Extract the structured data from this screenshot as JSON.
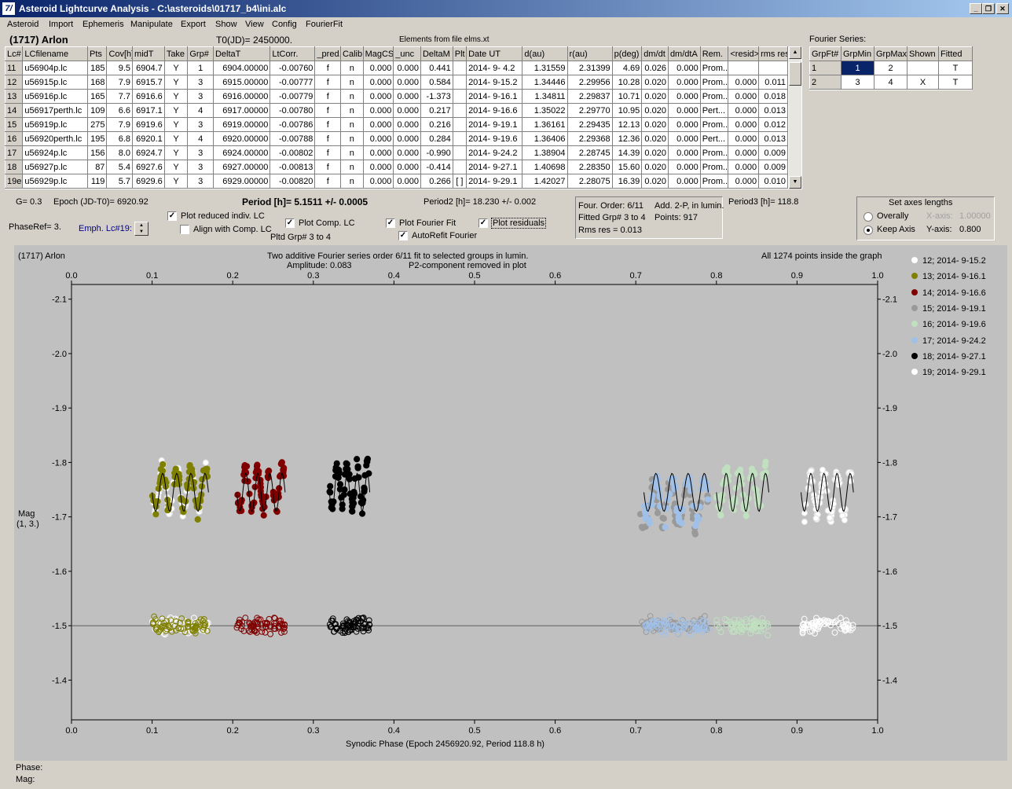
{
  "window": {
    "title": "Asteroid Lightcurve Analysis - C:\\asteroids\\01717_b4\\ini.alc"
  },
  "menu": [
    "Asteroid",
    "Import",
    "Ephemeris",
    "Manipulate",
    "Export",
    "Show",
    "View",
    "Config",
    "FourierFit"
  ],
  "header": {
    "asteroid": "(1717) Arlon",
    "t0": "T0(JD)= 2450000.",
    "elements": "Elements from file elms.xt",
    "fourier_series": "Fourier Series:"
  },
  "table": {
    "columns": [
      "Lc#",
      "LCfilename",
      "Pts",
      "Cov[h]",
      "midT",
      "Take",
      "Grp#",
      "DeltaT",
      "LtCorr.",
      "_pred.",
      "Calib.",
      "MagCS",
      "_unc",
      "DeltaM",
      "Plt",
      "Date UT",
      "d(au)",
      "r(au)",
      "p(deg)",
      "dm/dt",
      "dm/dtA",
      "Rem.",
      "<resid>",
      "rms res"
    ],
    "rows": [
      [
        "11",
        "u56904p.lc",
        "185",
        "9.5",
        "6904.7",
        "Y",
        "1",
        "6904.00000",
        "-0.00760",
        "f",
        "n",
        "0.000",
        "0.000",
        "0.441",
        "",
        "2014- 9- 4.2",
        "1.31559",
        "2.31399",
        "4.69",
        "0.026",
        "0.000",
        "Prom...",
        "",
        ""
      ],
      [
        "12",
        "u56915p.lc",
        "168",
        "7.9",
        "6915.7",
        "Y",
        "3",
        "6915.00000",
        "-0.00777",
        "f",
        "n",
        "0.000",
        "0.000",
        "0.584",
        "",
        "2014- 9-15.2",
        "1.34446",
        "2.29956",
        "10.28",
        "0.020",
        "0.000",
        "Prom...",
        "0.000",
        "0.011"
      ],
      [
        "13",
        "u56916p.lc",
        "165",
        "7.7",
        "6916.6",
        "Y",
        "3",
        "6916.00000",
        "-0.00779",
        "f",
        "n",
        "0.000",
        "0.000",
        "-1.373",
        "",
        "2014- 9-16.1",
        "1.34811",
        "2.29837",
        "10.71",
        "0.020",
        "0.000",
        "Prom...",
        "0.000",
        "0.018"
      ],
      [
        "14",
        "u56917perth.lc",
        "109",
        "6.6",
        "6917.1",
        "Y",
        "4",
        "6917.00000",
        "-0.00780",
        "f",
        "n",
        "0.000",
        "0.000",
        "0.217",
        "",
        "2014- 9-16.6",
        "1.35022",
        "2.29770",
        "10.95",
        "0.020",
        "0.000",
        "Pert...",
        "0.000",
        "0.013"
      ],
      [
        "15",
        "u56919p.lc",
        "275",
        "7.9",
        "6919.6",
        "Y",
        "3",
        "6919.00000",
        "-0.00786",
        "f",
        "n",
        "0.000",
        "0.000",
        "0.216",
        "",
        "2014- 9-19.1",
        "1.36161",
        "2.29435",
        "12.13",
        "0.020",
        "0.000",
        "Prom...",
        "0.000",
        "0.012"
      ],
      [
        "16",
        "u56920perth.lc",
        "195",
        "6.8",
        "6920.1",
        "Y",
        "4",
        "6920.00000",
        "-0.00788",
        "f",
        "n",
        "0.000",
        "0.000",
        "0.284",
        "",
        "2014- 9-19.6",
        "1.36406",
        "2.29368",
        "12.36",
        "0.020",
        "0.000",
        "Pert...",
        "0.000",
        "0.013"
      ],
      [
        "17",
        "u56924p.lc",
        "156",
        "8.0",
        "6924.7",
        "Y",
        "3",
        "6924.00000",
        "-0.00802",
        "f",
        "n",
        "0.000",
        "0.000",
        "-0.990",
        "",
        "2014- 9-24.2",
        "1.38904",
        "2.28745",
        "14.39",
        "0.020",
        "0.000",
        "Prom...",
        "0.000",
        "0.009"
      ],
      [
        "18",
        "u56927p.lc",
        "87",
        "5.4",
        "6927.6",
        "Y",
        "3",
        "6927.00000",
        "-0.00813",
        "f",
        "n",
        "0.000",
        "0.000",
        "-0.414",
        "",
        "2014- 9-27.1",
        "1.40698",
        "2.28350",
        "15.60",
        "0.020",
        "0.000",
        "Prom...",
        "0.000",
        "0.009"
      ],
      [
        "19e",
        "u56929p.lc",
        "119",
        "5.7",
        "6929.6",
        "Y",
        "3",
        "6929.00000",
        "-0.00820",
        "f",
        "n",
        "0.000",
        "0.000",
        "0.266",
        "[ ]",
        "2014- 9-29.1",
        "1.42027",
        "2.28075",
        "16.39",
        "0.020",
        "0.000",
        "Prom...",
        "0.000",
        "0.010"
      ]
    ]
  },
  "fourier_table": {
    "columns": [
      "GrpFt#",
      "GrpMin",
      "GrpMax",
      "Shown",
      "Fitted"
    ],
    "rows": [
      [
        "1",
        "1",
        "2",
        "",
        "T"
      ],
      [
        "2",
        "3",
        "4",
        "X",
        "T"
      ]
    ]
  },
  "info": {
    "g": "G= 0.3",
    "epoch": "Epoch (JD-T0)= 6920.92",
    "period": "Period [h]= 5.1511 +/- 0.0005",
    "period2": "Period2 [h]= 18.230 +/- 0.002",
    "period3": "Period3 [h]= 118.8",
    "phaseref": "PhaseRef= 3.",
    "emph": "Emph. Lc#19:",
    "four_order": "Four. Order:  6/11",
    "add2p": "Add. 2-P, in lumin.",
    "fitted_grp": "Fitted Grp# 3 to 4",
    "points": "Points: 917",
    "rms": "Rms res     = 0.013",
    "pltd_grp": "Pltd Grp#  3   to   4"
  },
  "checks": {
    "reduced": "Plot reduced indiv. LC",
    "align": "Align with Comp. LC",
    "comp": "Plot Comp. LC",
    "fourier": "Plot Fourier Fit",
    "autorefit": "AutoRefit Fourier",
    "residuals": "Plot residuals"
  },
  "axes_box": {
    "title": "Set axes lengths",
    "overally": "Overally",
    "keep": "Keep Axis",
    "xaxis_label": "X-axis:",
    "xaxis_val": "1.00000",
    "yaxis_label": "Y-axis:",
    "yaxis_val": "0.800"
  },
  "plot": {
    "name": "(1717) Arlon",
    "line1": "Two additive Fourier series order 6/11 fit to selected groups in lumin.",
    "line2": "Amplitude: 0.083",
    "line3": "P2-component removed in plot",
    "inside": "All 1274 points inside the graph",
    "ylabel1": "Mag",
    "ylabel2": "(1, 3.)",
    "xlabel": "Synodic Phase (Epoch 2456920.92, Period 118.8 h)"
  },
  "chart_data": {
    "type": "scatter",
    "xlim": [
      0,
      1
    ],
    "ylim": [
      -2.2,
      -1.3
    ],
    "xticks": [
      "0.0",
      "0.1",
      "0.2",
      "0.3",
      "0.4",
      "0.5",
      "0.6",
      "0.7",
      "0.8",
      "0.9",
      "1.0"
    ],
    "yticks": [
      "-2.1",
      "-2.0",
      "-1.9",
      "-1.8",
      "-1.7",
      "-1.6",
      "-1.5",
      "-1.4"
    ],
    "ytick_values": [
      -2.1,
      -2.0,
      -1.9,
      -1.8,
      -1.7,
      -1.6,
      -1.5,
      -1.4
    ],
    "reference_line": -1.5,
    "series": [
      {
        "name": "12; 2014- 9-15.2",
        "color": "#ffffff",
        "x": [
          0.1,
          0.17
        ],
        "center": -1.75
      },
      {
        "name": "13; 2014- 9-16.1",
        "color": "#808000",
        "x": [
          0.1,
          0.17
        ],
        "center": -1.75
      },
      {
        "name": "14; 2014- 9-16.6",
        "color": "#800000",
        "x": [
          0.205,
          0.265
        ],
        "center": -1.75
      },
      {
        "name": "15; 2014- 9-19.1",
        "color": "#999999",
        "x": [
          0.705,
          0.79
        ],
        "center": -1.72
      },
      {
        "name": "16; 2014- 9-19.6",
        "color": "#c0e0c0",
        "x": [
          0.8,
          0.865
        ],
        "center": -1.75
      },
      {
        "name": "17; 2014- 9-24.2",
        "color": "#a0c0e8",
        "x": [
          0.71,
          0.79
        ],
        "center": -1.73
      },
      {
        "name": "18; 2014- 9-27.1",
        "color": "#000000",
        "x": [
          0.32,
          0.37
        ],
        "center": -1.76
      },
      {
        "name": "19; 2014- 9-29.1",
        "color": "#ffffff",
        "x": [
          0.905,
          0.97
        ],
        "center": -1.74
      }
    ],
    "fit_curves": [
      [
        0.1,
        0.17
      ],
      [
        0.205,
        0.265
      ],
      [
        0.32,
        0.37
      ],
      [
        0.71,
        0.79
      ],
      [
        0.8,
        0.865
      ],
      [
        0.905,
        0.97
      ]
    ]
  },
  "status": {
    "phase": "Phase:",
    "mag": "Mag:"
  }
}
